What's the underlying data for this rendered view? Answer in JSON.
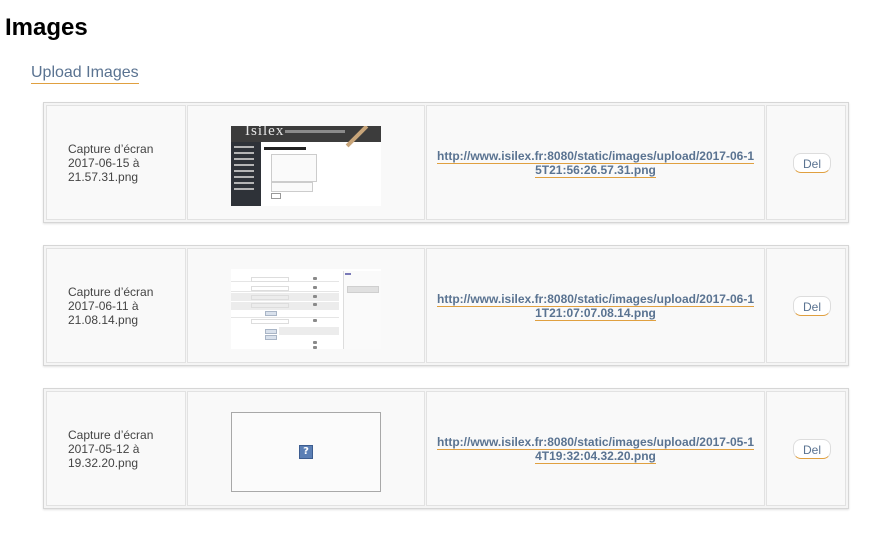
{
  "page": {
    "title": "Images",
    "upload_link": "Upload Images"
  },
  "images": [
    {
      "name": "Capture d’écran\n2017-06-15 à\n21.57.31.png",
      "url": "http://www.isilex.fr:8080/static/images/upload/2017-06-15T21:56:26.57.31.png",
      "thumbnail": "isilex-edit-css-screenshot",
      "thumbnail_text": "Isilex",
      "del_label": "Del"
    },
    {
      "name": "Capture d’écran\n2017-06-11 à\n21.08.14.png",
      "url": "http://www.isilex.fr:8080/static/images/upload/2017-06-11T21:07:07.08.14.png",
      "thumbnail": "form-screenshot",
      "del_label": "Del"
    },
    {
      "name": "Capture d’écran\n2017-05-12 à\n19.32.20.png",
      "url": "http://www.isilex.fr:8080/static/images/upload/2017-05-14T19:32:04.32.20.png",
      "thumbnail": "broken-image-icon",
      "thumbnail_glyph": "?",
      "del_label": "Del"
    }
  ],
  "colors": {
    "link": "#5a7391",
    "link_underline": "#e0a040",
    "row_background": "#f5f5f5"
  }
}
